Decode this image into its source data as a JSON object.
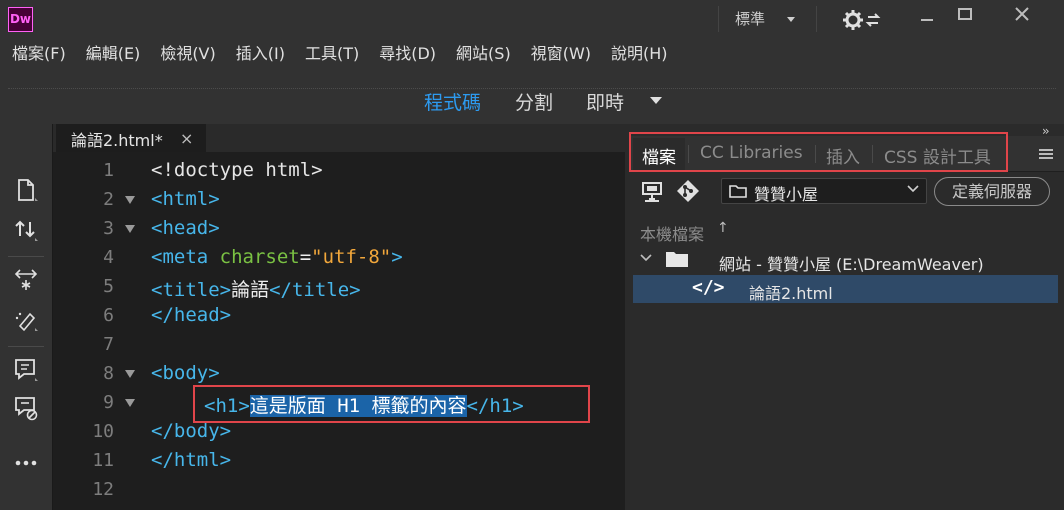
{
  "app": {
    "logo": "Dw",
    "workspace": "標準"
  },
  "menu": [
    "檔案(F)",
    "編輯(E)",
    "檢視(V)",
    "插入(I)",
    "工具(T)",
    "尋找(D)",
    "網站(S)",
    "視窗(W)",
    "說明(H)"
  ],
  "views": {
    "code": "程式碼",
    "split": "分割",
    "live": "即時",
    "active": "code"
  },
  "document": {
    "tab_label": "論語2.html*",
    "close_glyph": "×"
  },
  "code_lines": [
    {
      "n": "1"
    },
    {
      "n": "2"
    },
    {
      "n": "3"
    },
    {
      "n": "4"
    },
    {
      "n": "5"
    },
    {
      "n": "6"
    },
    {
      "n": "7"
    },
    {
      "n": "8"
    },
    {
      "n": "9"
    },
    {
      "n": "10"
    },
    {
      "n": "11"
    },
    {
      "n": "12"
    }
  ],
  "code": {
    "l1": "<!doctype html>",
    "l2_open": "<html>",
    "l3_open": "<head>",
    "l4_meta": "<meta",
    "l4_attr": " charset",
    "l4_eq": "=",
    "l4_val": "\"utf-8\"",
    "l4_close": ">",
    "l5_open": "<title>",
    "l5_text": "論語",
    "l5_close": "</title>",
    "l6": "</head>",
    "l8": "<body>",
    "l9_open": "<h1>",
    "l9_text": "這是版面 H1 標籤的內容",
    "l9_close": "</h1>",
    "l10": "</body>",
    "l11": "</html>"
  },
  "panel": {
    "tabs": [
      "檔案",
      "CC Libraries",
      "插入",
      "CSS 設計工具"
    ],
    "site_select": "贊贊小屋",
    "define_server": "定義伺服器",
    "local_files": "本機檔案",
    "local_files_sort": "↑",
    "tree": {
      "site": "網站 - 贊贊小屋 (E:\\DreamWeaver)",
      "file": "論語2.html",
      "file_icon_glyph": "</>"
    }
  },
  "colors": {
    "accent": "#2d9bf0",
    "highlight_box": "#e0454a",
    "tag": "#47b6ea",
    "attr": "#7ac143",
    "string": "#f2a73b",
    "selection": "#1b64a8"
  }
}
